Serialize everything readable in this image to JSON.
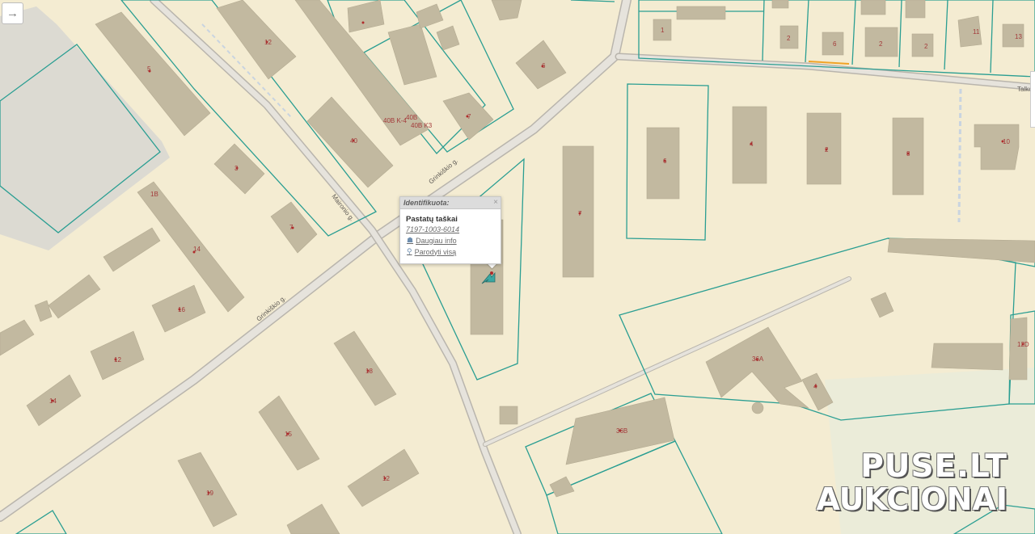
{
  "map": {
    "streets": {
      "grinkiskio_1": "Grinkiškio g.",
      "grinkiskio_2": "Grinkiškio g.",
      "maironio": "Maironio g.",
      "talko": "Talko"
    },
    "house_numbers": {
      "n5": "5",
      "n12a": "12",
      "n40": "40",
      "n40b_k4": "40B K-4",
      "n40b_k3": "40B K3",
      "n40b": "40B",
      "n6a": "6",
      "n7a": "7",
      "n3": "3",
      "n1b": "1B",
      "n7b": "7",
      "n14a": "14",
      "n16": "16",
      "n12b": "12",
      "n14b": "14",
      "n18": "18",
      "n15": "15",
      "n19": "19",
      "n12c": "12",
      "n7c": "7",
      "n6b": "6",
      "n4": "4",
      "n2a": "2",
      "n8": "8",
      "n10": "10",
      "n1c": "1",
      "n2b": "2",
      "n6c": "6",
      "n2c": "2",
      "n2d": "2",
      "n11": "11",
      "n13": "13",
      "n36a": "36A",
      "n36b": "36B",
      "n12d": "12D",
      "n4b": "4"
    }
  },
  "popup": {
    "header": "Identifikuota:",
    "close": "×",
    "title": "Pastatų taškai",
    "code": "7197-1003-6014",
    "link_more": "Daugiau info",
    "link_show_all": "Parodyti visą"
  },
  "toolbar": {
    "expand_icon": "→"
  },
  "watermark": {
    "line1": "PUSE.LT",
    "line2": "AUKCIONAI"
  },
  "colors": {
    "background": "#f4ecd2",
    "building": "#c2b9a0",
    "parcel": "#2a9e92",
    "road": "#e6e3dc",
    "label": "#a33a3a"
  }
}
